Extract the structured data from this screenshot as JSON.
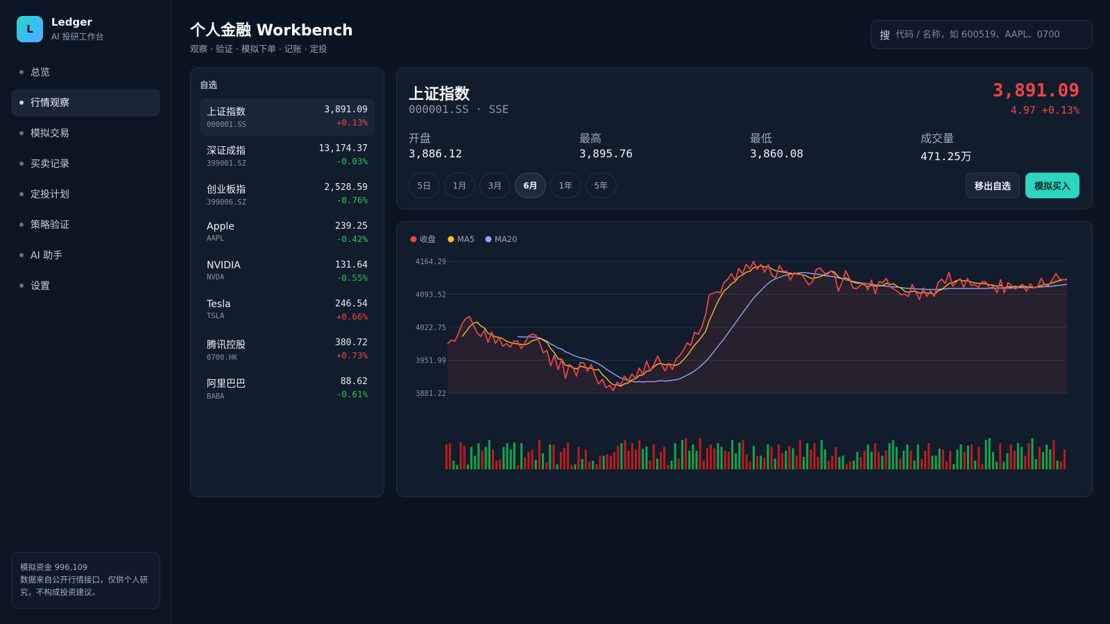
{
  "brand": {
    "logo_letter": "L",
    "name": "Ledger",
    "subtitle": "AI 投研工作台"
  },
  "nav": [
    {
      "label": "总览",
      "active": false
    },
    {
      "label": "行情观察",
      "active": true
    },
    {
      "label": "模拟交易",
      "active": false
    },
    {
      "label": "买卖记录",
      "active": false
    },
    {
      "label": "定投计划",
      "active": false
    },
    {
      "label": "策略验证",
      "active": false
    },
    {
      "label": "AI 助手",
      "active": false
    },
    {
      "label": "设置",
      "active": false
    }
  ],
  "footer": {
    "line1": "模拟资金 996,109",
    "line2": "数据来自公开行情接口，仅供个人研究，不构成投资建议。"
  },
  "header": {
    "title": "个人金融 Workbench",
    "subtitle": "观察 · 验证 · 模拟下单 · 记账 · 定投"
  },
  "search": {
    "icon_label": "搜",
    "placeholder": "代码 / 名称，如 600519、AAPL、0700"
  },
  "watchlist": {
    "title": "自选",
    "items": [
      {
        "name": "上证指数",
        "code": "000001.SS",
        "price": "3,891.09",
        "change": "+0.13%",
        "dir": "up",
        "active": true
      },
      {
        "name": "深证成指",
        "code": "399001.SZ",
        "price": "13,174.37",
        "change": "-0.03%",
        "dir": "down",
        "active": false
      },
      {
        "name": "创业板指",
        "code": "399006.SZ",
        "price": "2,528.59",
        "change": "-0.76%",
        "dir": "down",
        "active": false
      },
      {
        "name": "Apple",
        "code": "AAPL",
        "price": "239.25",
        "change": "-0.42%",
        "dir": "down",
        "active": false
      },
      {
        "name": "NVIDIA",
        "code": "NVDA",
        "price": "131.64",
        "change": "-0.55%",
        "dir": "down",
        "active": false
      },
      {
        "name": "Tesla",
        "code": "TSLA",
        "price": "246.54",
        "change": "+0.66%",
        "dir": "up",
        "active": false
      },
      {
        "name": "腾讯控股",
        "code": "0700.HK",
        "price": "380.72",
        "change": "+0.73%",
        "dir": "up",
        "active": false
      },
      {
        "name": "阿里巴巴",
        "code": "BABA",
        "price": "88.62",
        "change": "-0.61%",
        "dir": "down",
        "active": false
      }
    ]
  },
  "quote": {
    "name": "上证指数",
    "code_line": "000001.SS · SSE",
    "price": "3,891.09",
    "change": "4.97 +0.13%",
    "stats": [
      {
        "label": "开盘",
        "value": "3,886.12"
      },
      {
        "label": "最高",
        "value": "3,895.76"
      },
      {
        "label": "最低",
        "value": "3,860.08"
      },
      {
        "label": "成交量",
        "value": "471.25万"
      }
    ],
    "ranges": [
      {
        "label": "5日",
        "active": false
      },
      {
        "label": "1月",
        "active": false
      },
      {
        "label": "3月",
        "active": false
      },
      {
        "label": "6月",
        "active": true
      },
      {
        "label": "1年",
        "active": false
      },
      {
        "label": "5年",
        "active": false
      }
    ],
    "remove_label": "移出自选",
    "buy_label": "模拟买入"
  },
  "colors": {
    "up": "#ef4444",
    "down": "#22c55e",
    "accent": "#2dd4bf",
    "close": "#ef4444",
    "ma5": "#fbbf24",
    "ma20": "#8ea6f8"
  },
  "chart_data": {
    "type": "line",
    "legend": [
      {
        "name": "收盘",
        "color": "#ef4444"
      },
      {
        "name": "MA5",
        "color": "#fbbf24"
      },
      {
        "name": "MA20",
        "color": "#8ea6f8"
      }
    ],
    "ylim": [
      3881.22,
      4164.29
    ],
    "yticks": [
      "4164.29",
      "4093.52",
      "4022.75",
      "3951.99",
      "3881.22"
    ],
    "close": [
      3987,
      3995,
      3993,
      4010,
      4031,
      4042,
      4046,
      4028,
      4012,
      4003,
      4016,
      3990,
      4013,
      3988,
      4000,
      3982,
      3988,
      3980,
      3993,
      3993,
      3977,
      3990,
      4004,
      4008,
      4005,
      3990,
      3968,
      3973,
      3940,
      3963,
      3932,
      3955,
      3913,
      3943,
      3937,
      3918,
      3947,
      3946,
      3928,
      3943,
      3920,
      3901,
      3911,
      3893,
      3898,
      3887,
      3905,
      3899,
      3918,
      3907,
      3922,
      3913,
      3935,
      3921,
      3950,
      3929,
      3943,
      3961,
      3944,
      3929,
      3945,
      3932,
      3955,
      3962,
      3974,
      3989,
      3984,
      4012,
      4008,
      4024,
      4050,
      4093,
      4096,
      4099,
      4097,
      4119,
      4126,
      4138,
      4123,
      4149,
      4138,
      4158,
      4149,
      4164,
      4147,
      4158,
      4141,
      4157,
      4134,
      4129,
      4155,
      4143,
      4143,
      4124,
      4140,
      4136,
      4137,
      4125,
      4114,
      4121,
      4147,
      4150,
      4141,
      4136,
      4144,
      4136,
      4100,
      4120,
      4144,
      4128,
      4107,
      4106,
      4113,
      4118,
      4103,
      4124,
      4095,
      4121,
      4118,
      4128,
      4110,
      4105,
      4100,
      4093,
      4094,
      4089,
      4115,
      4099,
      4082,
      4107,
      4089,
      4101,
      4089,
      4118,
      4126,
      4117,
      4141,
      4111,
      4120,
      4127,
      4109,
      4128,
      4113,
      4114,
      4109,
      4121,
      4120,
      4106,
      4111,
      4097,
      4125,
      4097,
      4119,
      4112,
      4105,
      4111,
      4115,
      4100,
      4116,
      4107,
      4109,
      4128,
      4114,
      4112,
      4125,
      4138,
      4126,
      4125,
      4125
    ],
    "ma5": [
      null,
      null,
      null,
      null,
      4003,
      4013,
      4024,
      4031,
      4034,
      4026,
      4021,
      4010,
      4007,
      4002,
      4001,
      3998,
      3993,
      3990,
      3988,
      3987,
      3986,
      3985,
      3988,
      3994,
      3996,
      3999,
      3995,
      3990,
      3977,
      3968,
      3955,
      3953,
      3941,
      3940,
      3936,
      3933,
      3939,
      3937,
      3935,
      3935,
      3931,
      3932,
      3921,
      3914,
      3905,
      3899,
      3899,
      3896,
      3901,
      3903,
      3910,
      3912,
      3919,
      3920,
      3928,
      3930,
      3938,
      3944,
      3945,
      3942,
      3944,
      3942,
      3941,
      3945,
      3953,
      3962,
      3973,
      3984,
      3993,
      4003,
      4014,
      4037,
      4054,
      4073,
      4087,
      4101,
      4107,
      4116,
      4121,
      4131,
      4135,
      4141,
      4143,
      4151,
      4152,
      4155,
      4152,
      4153,
      4148,
      4144,
      4143,
      4141,
      4140,
      4139,
      4137,
      4139,
      4136,
      4134,
      4130,
      4127,
      4129,
      4131,
      4135,
      4139,
      4144,
      4141,
      4131,
      4127,
      4129,
      4125,
      4120,
      4117,
      4118,
      4114,
      4110,
      4113,
      4111,
      4112,
      4112,
      4117,
      4115,
      4116,
      4110,
      4107,
      4100,
      4098,
      4100,
      4100,
      4096,
      4098,
      4096,
      4096,
      4093,
      4101,
      4104,
      4110,
      4117,
      4118,
      4123,
      4125,
      4122,
      4123,
      4120,
      4118,
      4117,
      4117,
      4116,
      4114,
      4113,
      4111,
      4113,
      4107,
      4110,
      4109,
      4111,
      4109,
      4111,
      4110,
      4109,
      4108,
      4110,
      4112,
      4115,
      4115,
      4118,
      4121,
      4123,
      4125,
      4126
    ],
    "ma20": [
      null,
      null,
      null,
      null,
      null,
      null,
      null,
      null,
      null,
      null,
      null,
      null,
      null,
      null,
      null,
      null,
      null,
      null,
      null,
      4003,
      4002,
      4002,
      4002,
      4002,
      4001,
      4000,
      3996,
      3993,
      3987,
      3983,
      3978,
      3976,
      3970,
      3967,
      3963,
      3960,
      3957,
      3956,
      3953,
      3951,
      3948,
      3944,
      3939,
      3933,
      3928,
      3923,
      3918,
      3914,
      3911,
      3908,
      3907,
      3905,
      3906,
      3905,
      3906,
      3906,
      3906,
      3907,
      3908,
      3907,
      3908,
      3909,
      3910,
      3912,
      3916,
      3920,
      3924,
      3929,
      3935,
      3942,
      3949,
      3958,
      3968,
      3978,
      3988,
      3998,
      4009,
      4020,
      4031,
      4042,
      4053,
      4064,
      4075,
      4085,
      4094,
      4102,
      4110,
      4117,
      4123,
      4127,
      4130,
      4133,
      4135,
      4137,
      4138,
      4139,
      4140,
      4140,
      4139,
      4138,
      4137,
      4136,
      4134,
      4133,
      4132,
      4131,
      4129,
      4127,
      4125,
      4123,
      4121,
      4120,
      4118,
      4117,
      4116,
      4115,
      4114,
      4113,
      4112,
      4111,
      4110,
      4109,
      4109,
      4108,
      4107,
      4106,
      4106,
      4105,
      4105,
      4105,
      4104,
      4104,
      4104,
      4104,
      4105,
      4105,
      4106,
      4106,
      4106,
      4106,
      4106,
      4106,
      4106,
      4106,
      4106,
      4106,
      4106,
      4106,
      4107,
      4107,
      4107,
      4107,
      4107,
      4107,
      4108,
      4108,
      4108,
      4108,
      4108,
      4108,
      4109,
      4109,
      4110,
      4110,
      4111,
      4112,
      4113,
      4114,
      4115
    ],
    "volume": [
      {
        "v": 0.8,
        "c": "down"
      },
      {
        "v": 0.84,
        "c": "down"
      },
      {
        "v": 0.28,
        "c": "up"
      },
      {
        "v": 0.14,
        "c": "up"
      },
      {
        "v": 0.87,
        "c": "down"
      },
      {
        "v": 0.76,
        "c": "down"
      },
      {
        "v": 0.16,
        "c": "up"
      },
      {
        "v": 0.72,
        "c": "up"
      },
      {
        "v": 0.44,
        "c": "up"
      },
      {
        "v": 0.84,
        "c": "up"
      },
      {
        "v": 0.6,
        "c": "down"
      },
      {
        "v": 0.72,
        "c": "up"
      },
      {
        "v": 0.94,
        "c": "up"
      },
      {
        "v": 0.64,
        "c": "down"
      },
      {
        "v": 0.28,
        "c": "down"
      },
      {
        "v": 0.31,
        "c": "down"
      },
      {
        "v": 0.72,
        "c": "up"
      },
      {
        "v": 0.84,
        "c": "up"
      },
      {
        "v": 0.64,
        "c": "up"
      },
      {
        "v": 0.86,
        "c": "up"
      },
      {
        "v": 0.14,
        "c": "down"
      },
      {
        "v": 0.84,
        "c": "up"
      },
      {
        "v": 0.38,
        "c": "down"
      },
      {
        "v": 0.57,
        "c": "down"
      },
      {
        "v": 0.63,
        "c": "down"
      },
      {
        "v": 0.31,
        "c": "up"
      },
      {
        "v": 0.94,
        "c": "down"
      },
      {
        "v": 0.52,
        "c": "up"
      },
      {
        "v": 0.22,
        "c": "down"
      },
      {
        "v": 0.8,
        "c": "up"
      },
      {
        "v": 0.8,
        "c": "down"
      },
      {
        "v": 0.16,
        "c": "up"
      },
      {
        "v": 0.56,
        "c": "down"
      },
      {
        "v": 0.68,
        "c": "down"
      },
      {
        "v": 0.86,
        "c": "down"
      },
      {
        "v": 0.14,
        "c": "down"
      },
      {
        "v": 0.16,
        "c": "up"
      },
      {
        "v": 0.72,
        "c": "down"
      },
      {
        "v": 0.33,
        "c": "up"
      },
      {
        "v": 0.64,
        "c": "down"
      },
      {
        "v": 0.25,
        "c": "down"
      },
      {
        "v": 0.28,
        "c": "up"
      },
      {
        "v": 0.17,
        "c": "down"
      },
      {
        "v": 0.44,
        "c": "down"
      },
      {
        "v": 0.44,
        "c": "up"
      },
      {
        "v": 0.48,
        "c": "down"
      },
      {
        "v": 0.44,
        "c": "down"
      },
      {
        "v": 0.56,
        "c": "down"
      },
      {
        "v": 0.76,
        "c": "down"
      },
      {
        "v": 0.84,
        "c": "up"
      },
      {
        "v": 0.94,
        "c": "down"
      },
      {
        "v": 0.6,
        "c": "down"
      },
      {
        "v": 0.84,
        "c": "down"
      },
      {
        "v": 0.64,
        "c": "down"
      },
      {
        "v": 0.94,
        "c": "down"
      },
      {
        "v": 0.66,
        "c": "up"
      },
      {
        "v": 0.73,
        "c": "up"
      },
      {
        "v": 0.28,
        "c": "down"
      },
      {
        "v": 0.8,
        "c": "down"
      },
      {
        "v": 0.35,
        "c": "up"
      },
      {
        "v": 0.56,
        "c": "down"
      },
      {
        "v": 0.73,
        "c": "down"
      },
      {
        "v": 0.14,
        "c": "down"
      },
      {
        "v": 0.28,
        "c": "up"
      },
      {
        "v": 0.84,
        "c": "up"
      },
      {
        "v": 0.35,
        "c": "down"
      },
      {
        "v": 0.94,
        "c": "up"
      },
      {
        "v": 1.0,
        "c": "down"
      },
      {
        "v": 0.6,
        "c": "up"
      },
      {
        "v": 0.8,
        "c": "up"
      },
      {
        "v": 0.6,
        "c": "up"
      },
      {
        "v": 1.0,
        "c": "down"
      },
      {
        "v": 0.28,
        "c": "down"
      },
      {
        "v": 0.68,
        "c": "down"
      },
      {
        "v": 0.8,
        "c": "down"
      },
      {
        "v": 0.67,
        "c": "down"
      },
      {
        "v": 0.84,
        "c": "up"
      },
      {
        "v": 0.72,
        "c": "up"
      },
      {
        "v": 0.6,
        "c": "down"
      },
      {
        "v": 0.57,
        "c": "down"
      },
      {
        "v": 0.94,
        "c": "up"
      },
      {
        "v": 0.52,
        "c": "up"
      },
      {
        "v": 0.86,
        "c": "up"
      },
      {
        "v": 0.94,
        "c": "down"
      },
      {
        "v": 0.48,
        "c": "down"
      },
      {
        "v": 0.25,
        "c": "down"
      },
      {
        "v": 0.76,
        "c": "up"
      },
      {
        "v": 0.44,
        "c": "down"
      },
      {
        "v": 0.44,
        "c": "up"
      },
      {
        "v": 0.38,
        "c": "down"
      },
      {
        "v": 0.8,
        "c": "up"
      },
      {
        "v": 0.72,
        "c": "down"
      },
      {
        "v": 0.35,
        "c": "up"
      },
      {
        "v": 0.8,
        "c": "down"
      },
      {
        "v": 0.52,
        "c": "down"
      },
      {
        "v": 0.6,
        "c": "up"
      },
      {
        "v": 0.75,
        "c": "down"
      },
      {
        "v": 0.68,
        "c": "up"
      },
      {
        "v": 0.44,
        "c": "down"
      },
      {
        "v": 0.94,
        "c": "down"
      },
      {
        "v": 0.4,
        "c": "up"
      },
      {
        "v": 0.84,
        "c": "up"
      },
      {
        "v": 0.64,
        "c": "down"
      },
      {
        "v": 0.84,
        "c": "down"
      },
      {
        "v": 0.4,
        "c": "down"
      },
      {
        "v": 0.94,
        "c": "up"
      },
      {
        "v": 0.64,
        "c": "up"
      },
      {
        "v": 0.28,
        "c": "down"
      },
      {
        "v": 0.44,
        "c": "down"
      },
      {
        "v": 0.72,
        "c": "down"
      },
      {
        "v": 0.4,
        "c": "up"
      },
      {
        "v": 0.44,
        "c": "up"
      },
      {
        "v": 0.17,
        "c": "down"
      },
      {
        "v": 0.25,
        "c": "down"
      },
      {
        "v": 0.28,
        "c": "up"
      },
      {
        "v": 0.56,
        "c": "up"
      },
      {
        "v": 0.4,
        "c": "down"
      },
      {
        "v": 0.6,
        "c": "down"
      },
      {
        "v": 0.8,
        "c": "up"
      },
      {
        "v": 0.57,
        "c": "up"
      },
      {
        "v": 0.84,
        "c": "down"
      },
      {
        "v": 0.56,
        "c": "down"
      },
      {
        "v": 0.44,
        "c": "up"
      },
      {
        "v": 0.6,
        "c": "down"
      },
      {
        "v": 0.84,
        "c": "up"
      },
      {
        "v": 0.94,
        "c": "up"
      },
      {
        "v": 0.72,
        "c": "up"
      },
      {
        "v": 0.35,
        "c": "down"
      },
      {
        "v": 0.6,
        "c": "up"
      },
      {
        "v": 0.8,
        "c": "up"
      },
      {
        "v": 0.6,
        "c": "down"
      },
      {
        "v": 0.28,
        "c": "up"
      },
      {
        "v": 0.8,
        "c": "up"
      },
      {
        "v": 0.33,
        "c": "down"
      },
      {
        "v": 0.6,
        "c": "down"
      },
      {
        "v": 0.84,
        "c": "down"
      },
      {
        "v": 0.44,
        "c": "up"
      },
      {
        "v": 0.44,
        "c": "up"
      },
      {
        "v": 0.67,
        "c": "up"
      },
      {
        "v": 0.64,
        "c": "down"
      },
      {
        "v": 0.25,
        "c": "down"
      },
      {
        "v": 0.6,
        "c": "down"
      },
      {
        "v": 0.17,
        "c": "up"
      },
      {
        "v": 0.64,
        "c": "up"
      },
      {
        "v": 0.8,
        "c": "up"
      },
      {
        "v": 0.57,
        "c": "down"
      },
      {
        "v": 0.76,
        "c": "up"
      },
      {
        "v": 0.8,
        "c": "down"
      },
      {
        "v": 0.28,
        "c": "up"
      },
      {
        "v": 0.72,
        "c": "down"
      },
      {
        "v": 0.17,
        "c": "down"
      },
      {
        "v": 0.94,
        "c": "up"
      },
      {
        "v": 1.0,
        "c": "up"
      },
      {
        "v": 0.56,
        "c": "up"
      },
      {
        "v": 0.25,
        "c": "up"
      },
      {
        "v": 0.84,
        "c": "down"
      },
      {
        "v": 0.25,
        "c": "up"
      },
      {
        "v": 0.52,
        "c": "up"
      },
      {
        "v": 0.8,
        "c": "down"
      },
      {
        "v": 0.6,
        "c": "down"
      },
      {
        "v": 0.84,
        "c": "up"
      },
      {
        "v": 0.72,
        "c": "up"
      },
      {
        "v": 0.44,
        "c": "down"
      },
      {
        "v": 0.84,
        "c": "down"
      },
      {
        "v": 1.0,
        "c": "up"
      },
      {
        "v": 0.33,
        "c": "up"
      },
      {
        "v": 0.72,
        "c": "down"
      },
      {
        "v": 0.56,
        "c": "up"
      },
      {
        "v": 0.8,
        "c": "up"
      },
      {
        "v": 0.64,
        "c": "up"
      },
      {
        "v": 0.94,
        "c": "down"
      },
      {
        "v": 0.28,
        "c": "up"
      },
      {
        "v": 0.25,
        "c": "down"
      },
      {
        "v": 0.64,
        "c": "down"
      }
    ]
  }
}
